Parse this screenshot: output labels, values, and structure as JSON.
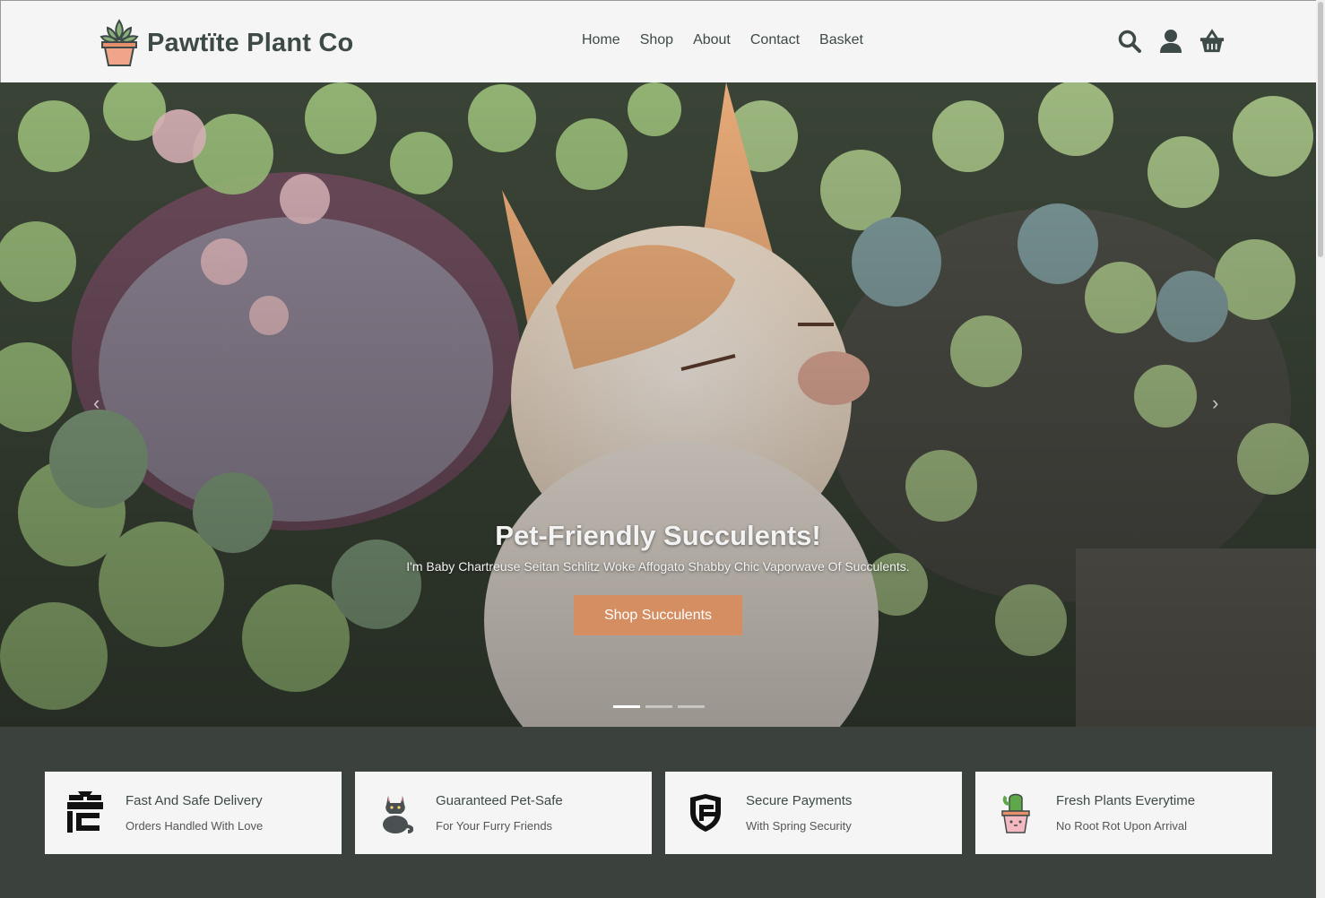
{
  "brand": {
    "name": "Pawtïte Plant Co",
    "logo_icon": "succulent-pot-icon"
  },
  "nav": [
    {
      "label": "Home"
    },
    {
      "label": "Shop"
    },
    {
      "label": "About"
    },
    {
      "label": "Contact"
    },
    {
      "label": "Basket"
    }
  ],
  "header_icons": [
    "search-icon",
    "user-icon",
    "basket-icon"
  ],
  "hero": {
    "title": "Pet-Friendly Succulents!",
    "subtitle": "I'm Baby Chartreuse Seitan Schlitz Woke Affogato Shabby Chic Vaporwave Of Succulents.",
    "cta_label": "Shop Succulents",
    "prev_arrow": "‹",
    "next_arrow": "›",
    "slide_count": 3,
    "active_slide": 1
  },
  "features": [
    {
      "title": "Fast And Safe Delivery",
      "subtitle": "Orders Handled With Love",
      "icon": "delivery-box-icon"
    },
    {
      "title": "Guaranteed Pet-Safe",
      "subtitle": "For Your Furry Friends",
      "icon": "cat-icon"
    },
    {
      "title": "Secure Payments",
      "subtitle": "With Spring Security",
      "icon": "shield-icon"
    },
    {
      "title": "Fresh Plants Everytime",
      "subtitle": "No Root Rot Upon Arrival",
      "icon": "cactus-pot-icon"
    }
  ],
  "colors": {
    "header_bg": "#f5f5f5",
    "text_dark": "#3d4a47",
    "accent": "#d48e62",
    "footer_bg": "#3b413c"
  }
}
